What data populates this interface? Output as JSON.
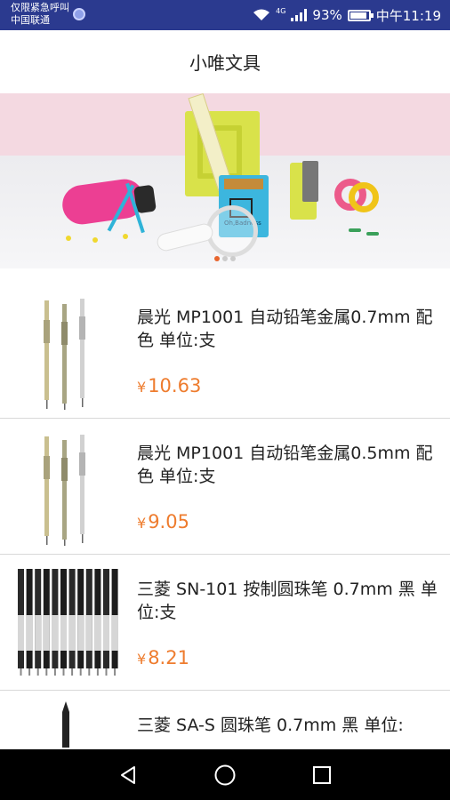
{
  "status_bar": {
    "carrier_line1": "仅限紧急呼叫",
    "carrier_line2": "中国联通",
    "net_type": "4G",
    "battery": "93%",
    "time": "中午11:19",
    "battery_level": 0.93,
    "icons": [
      "app-notification-icon",
      "wifi-icon",
      "signal-icon",
      "battery-icon"
    ]
  },
  "header": {
    "title": "小唯文具"
  },
  "banner": {
    "slide_count": 3,
    "active_slide": 1,
    "product_label": "Oh,Badness"
  },
  "products": [
    {
      "name": "晨光 MP1001 自动铅笔金属0.7mm 配色 单位:支",
      "currency": "¥",
      "price": "10.63"
    },
    {
      "name": "晨光 MP1001 自动铅笔金属0.5mm 配色 单位:支",
      "currency": "¥",
      "price": "9.05"
    },
    {
      "name": "三菱 SN-101 按制圆珠笔 0.7mm 黑 单位:支",
      "currency": "¥",
      "price": "8.21"
    },
    {
      "name": "三菱 SA-S 圆珠笔 0.7mm 黑 单位:",
      "currency": "¥",
      "price": ""
    }
  ],
  "nav_bar": {
    "icons": [
      "back-icon",
      "home-icon",
      "recents-icon"
    ]
  },
  "colors": {
    "status_bar": "#2b3a8f",
    "price": "#ee7c2e",
    "indicator_active": "#e8652e"
  }
}
